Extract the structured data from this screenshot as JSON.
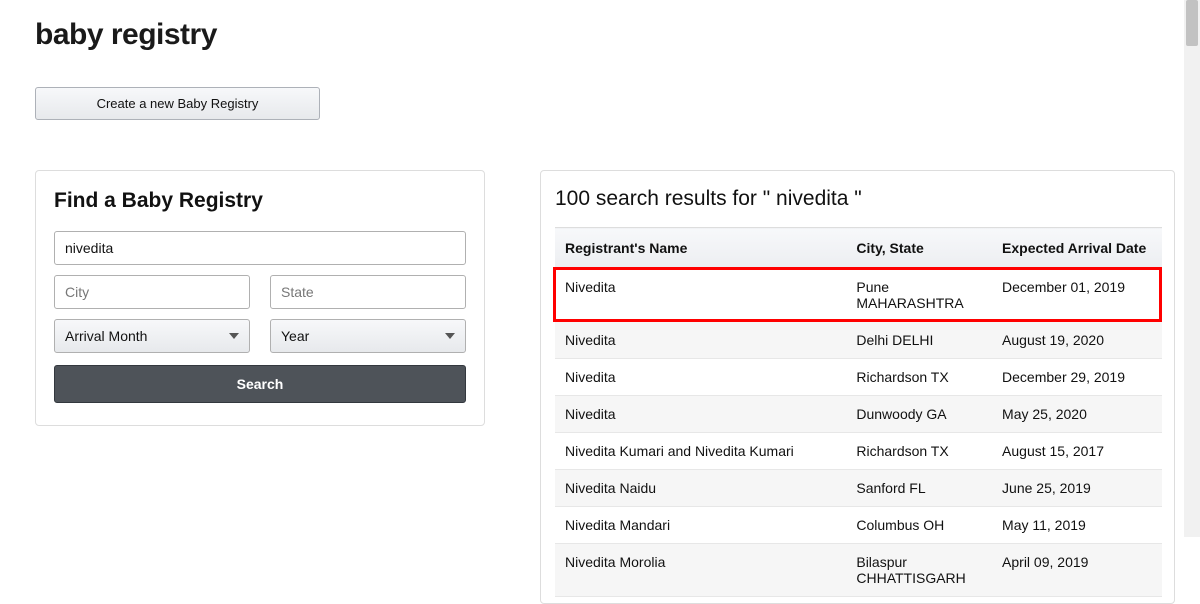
{
  "page_title": "baby registry",
  "create_button_label": "Create a new Baby Registry",
  "search_panel": {
    "heading": "Find a Baby Registry",
    "name_value": "nivedita",
    "city_placeholder": "City",
    "state_placeholder": "State",
    "month_label": "Arrival Month",
    "year_label": "Year",
    "search_button_label": "Search"
  },
  "results_panel": {
    "heading": "100 search results for \" nivedita \"",
    "columns": {
      "name": "Registrant's Name",
      "city": "City, State",
      "date": "Expected Arrival Date"
    },
    "rows": [
      {
        "name": "Nivedita",
        "city": "Pune MAHARASHTRA",
        "date": "December 01, 2019"
      },
      {
        "name": "Nivedita",
        "city": "Delhi DELHI",
        "date": "August 19, 2020"
      },
      {
        "name": "Nivedita",
        "city": "Richardson TX",
        "date": "December 29, 2019"
      },
      {
        "name": "Nivedita",
        "city": "Dunwoody GA",
        "date": "May 25, 2020"
      },
      {
        "name": "Nivedita Kumari and Nivedita Kumari",
        "city": "Richardson TX",
        "date": "August 15, 2017"
      },
      {
        "name": "Nivedita Naidu",
        "city": "Sanford FL",
        "date": "June 25, 2019"
      },
      {
        "name": "Nivedita Mandari",
        "city": "Columbus OH",
        "date": "May 11, 2019"
      },
      {
        "name": "Nivedita Morolia",
        "city": "Bilaspur CHHATTISGARH",
        "date": "April 09, 2019"
      }
    ],
    "highlighted_row_index": 0
  }
}
